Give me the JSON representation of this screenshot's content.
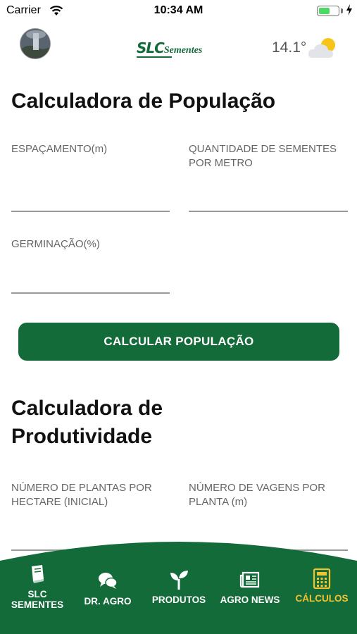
{
  "status_bar": {
    "carrier": "Carrier",
    "time": "10:34 AM",
    "battery_level": 0.6
  },
  "header": {
    "logo_main": "SLC",
    "logo_sub": "Sementes",
    "temperature": "14.1°",
    "weather_icon": "partly-cloudy-icon"
  },
  "population_calculator": {
    "title": "Calculadora de População",
    "spacing_label": "ESPAÇAMENTO(m)",
    "seeds_label_line1": "QUANTIDADE DE SEMENTES",
    "seeds_label_line2": "POR METRO",
    "germination_label": "GERMINAÇÃO(%)",
    "button_label": "CALCULAR POPULAÇÃO"
  },
  "productivity_calculator": {
    "title_line1": "Calculadora de",
    "title_line2": "Produtividade",
    "plants_label_line1": "NÚMERO DE PLANTAS POR",
    "plants_label_line2": "HECTARE (INICIAL)",
    "pods_label_line1": "NÚMERO DE VAGENS POR",
    "pods_label_line2": "PLANTA (m)"
  },
  "bottom_nav": {
    "accent_color": "#f2c230",
    "background_color": "#146b3a",
    "items": [
      {
        "label_line1": "SLC",
        "label_line2": "SEMENTES",
        "icon": "book-icon",
        "active": false
      },
      {
        "label": "DR. AGRO",
        "icon": "chat-bubbles-icon",
        "active": false
      },
      {
        "label": "PRODUTOS",
        "icon": "sprout-icon",
        "active": false
      },
      {
        "label": "AGRO NEWS",
        "icon": "newspaper-icon",
        "active": false
      },
      {
        "label": "CÁLCULOS",
        "icon": "calculator-icon",
        "active": true
      }
    ]
  }
}
